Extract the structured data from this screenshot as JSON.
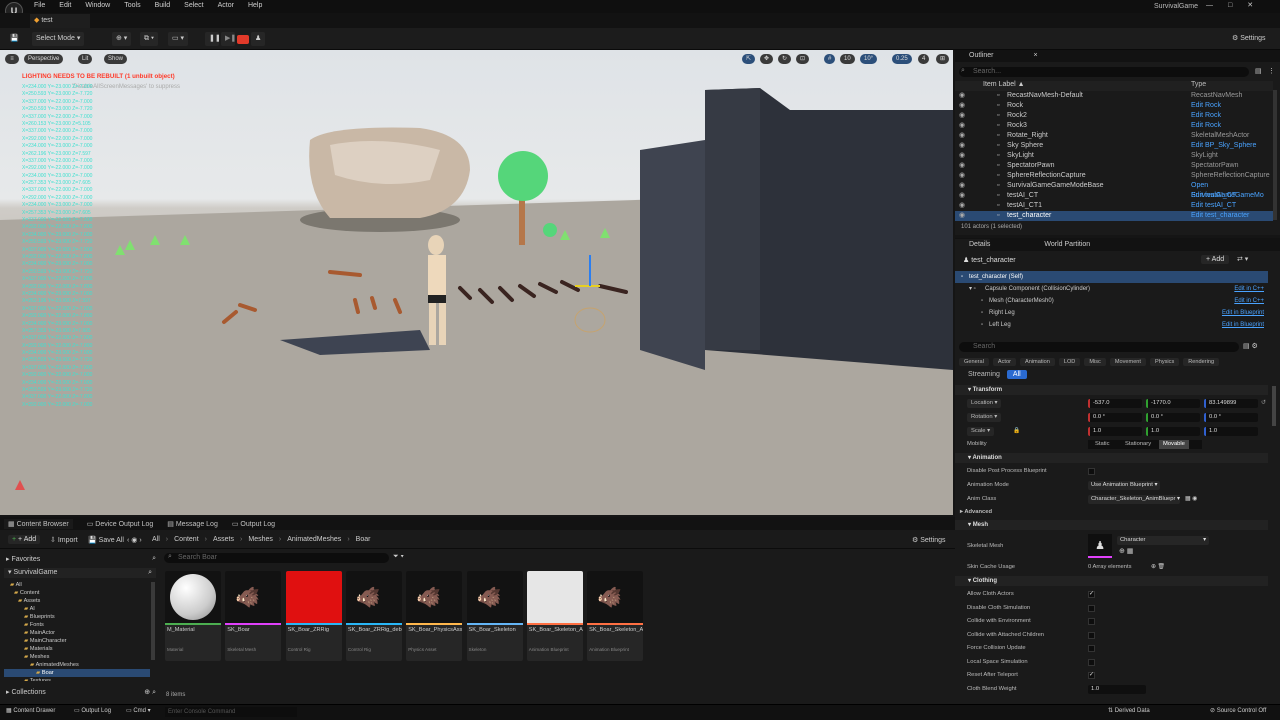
{
  "app": {
    "title": "SurvivalGame",
    "logo": "U",
    "doc_tab": "test"
  },
  "menu": [
    "File",
    "Edit",
    "Window",
    "Tools",
    "Build",
    "Select",
    "Actor",
    "Help"
  ],
  "window_buttons": [
    "—",
    "□",
    "✕"
  ],
  "toolbar": {
    "save_icon": "💾",
    "mode": "Select Mode",
    "settings": "Settings"
  },
  "viewport": {
    "perspective": "Perspective",
    "lit": "Lit",
    "show": "Show",
    "grid_size": "10",
    "angle": "10°",
    "scale": "0.25",
    "cam_speed": "4",
    "warning": "LIGHTING NEEDS TO BE REBUILT (1 unbuilt object)",
    "suppress_hint": "'DisableAllScreenMessages' to suppress",
    "coords": [
      "X=234.000 Y=-23.000 Z=-7.000",
      "X=250.593 Y=-23.000 Z=-7.720",
      "X=337.000 Y=-22.000 Z=-7.000",
      "X=250.593 Y=-23.000 Z=-7.720",
      "X=337.000 Y=-22.000 Z=-7.000",
      "X=260.153 Y=-23.000 Z=5.105",
      "X=337.000 Y=-22.000 Z=-7.000",
      "X=292.000 Y=-22.000 Z=-7.000",
      "X=234.000 Y=-23.000 Z=-7.000",
      "X=262.196 Y=-23.000 Z=7.597",
      "X=337.000 Y=-22.000 Z=-7.000",
      "X=292.000 Y=-22.000 Z=-7.000",
      "X=234.000 Y=-23.000 Z=-7.000",
      "X=257.353 Y=-23.000 Z=7.605",
      "X=337.000 Y=-22.000 Z=-7.000",
      "X=292.000 Y=-22.000 Z=-7.000",
      "X=234.000 Y=-23.000 Z=-7.000",
      "X=257.353 Y=-23.000 Z=7.605",
      "X=337.000 Y=-22.000 Z=-7.000",
      "X=292.000 Y=-22.000 Z=-7.000",
      "X=234.000 Y=-23.000 Z=-7.000",
      "X=250.593 Y=-23.000 Z=-7.720",
      "X=337.000 Y=-22.000 Z=-7.000",
      "X=292.000 Y=-22.000 Z=-7.000",
      "X=234.000 Y=-23.000 Z=-7.000",
      "X=250.593 Y=-23.000 Z=-7.720",
      "X=337.000 Y=-22.000 Z=-7.000",
      "X=292.000 Y=-22.000 Z=-7.000",
      "X=234.000 Y=-23.000 Z=-7.000",
      "X=262.196 Y=-23.000 Z=7.597",
      "X=337.000 Y=-22.000 Z=-7.000",
      "X=292.000 Y=-22.000 Z=-7.000",
      "X=234.000 Y=-23.000 Z=-7.000",
      "X=257.353 Y=-23.000 Z=7.605",
      "X=337.000 Y=-22.000 Z=-7.000",
      "X=292.000 Y=-22.000 Z=-7.000",
      "X=234.000 Y=-23.000 Z=-7.000",
      "X=250.593 Y=-23.000 Z=-7.720",
      "X=337.000 Y=-22.000 Z=-7.000",
      "X=292.000 Y=-22.000 Z=-7.000",
      "X=234.000 Y=-23.000 Z=-7.000",
      "X=250.593 Y=-23.000 Z=-7.720",
      "X=337.000 Y=-22.000 Z=-7.000",
      "X=292.000 Y=-22.000 Z=-7.000"
    ]
  },
  "outliner": {
    "tab": "Outliner",
    "search_placeholder": "Search...",
    "col_label": "Item Label ▲",
    "col_type": "Type",
    "rows": [
      {
        "name": "RecastNavMesh-Default",
        "type": "RecastNavMesh",
        "link": false
      },
      {
        "name": "Rock",
        "type": "Edit Rock",
        "link": true
      },
      {
        "name": "Rock2",
        "type": "Edit Rock",
        "link": true
      },
      {
        "name": "Rock3",
        "type": "Edit Rock",
        "link": true
      },
      {
        "name": "Rotate_Right",
        "type": "SkeletalMeshActor",
        "link": false
      },
      {
        "name": "Sky Sphere",
        "type": "Edit BP_Sky_Sphere",
        "link": true
      },
      {
        "name": "SkyLight",
        "type": "SkyLight",
        "link": false
      },
      {
        "name": "SpectatorPawn",
        "type": "SpectatorPawn",
        "link": false
      },
      {
        "name": "SphereReflectionCapture",
        "type": "SphereReflectionCapture",
        "link": false
      },
      {
        "name": "SurvivalGameGameModeBase",
        "type": "Open SurvivalGameGameMo",
        "link": true
      },
      {
        "name": "testAI_CT",
        "type": "Edit testAI_CT",
        "link": true
      },
      {
        "name": "testAI_CT1",
        "type": "Edit testAI_CT",
        "link": true
      },
      {
        "name": "test_character",
        "type": "Edit test_character",
        "link": true
      }
    ],
    "footer": "101 actors (1 selected)"
  },
  "details": {
    "tab": "Details",
    "tab2": "World Partition",
    "actor": "test_character",
    "add": "+ Add",
    "components": [
      {
        "name": "test_character (Self)",
        "link": ""
      },
      {
        "name": "Capsule Component (CollisionCylinder)",
        "link": "Edit in C++"
      },
      {
        "name": "Mesh (CharacterMesh0)",
        "link": "Edit in C++"
      },
      {
        "name": "Right Leg",
        "link": "Edit in Blueprint"
      },
      {
        "name": "Left Leg",
        "link": "Edit in Blueprint"
      }
    ],
    "search_placeholder": "Search",
    "filters": [
      "General",
      "Actor",
      "Animation",
      "LOD",
      "Misc",
      "Movement",
      "Physics",
      "Rendering"
    ],
    "filters2": [
      "Streaming",
      "All"
    ],
    "transform_header": "Transform",
    "location": {
      "label": "Location",
      "x": "-537.0",
      "y": "-1770.0",
      "z": "83.149899"
    },
    "rotation": {
      "label": "Rotation",
      "x": "0.0 °",
      "y": "0.0 °",
      "z": "0.0 °"
    },
    "scale": {
      "label": "Scale",
      "x": "1.0",
      "y": "1.0",
      "z": "1.0"
    },
    "mobility": {
      "label": "Mobility",
      "options": [
        "Static",
        "Stationary",
        "Movable"
      ]
    },
    "anim_header": "Animation",
    "anim_props": [
      {
        "label": "Disable Post Process Blueprint",
        "value": ""
      },
      {
        "label": "Animation Mode",
        "value": "Use Animation Blueprint"
      },
      {
        "label": "Anim Class",
        "value": "Character_Skeleton_AnimBluepr"
      }
    ],
    "advanced": "Advanced",
    "mesh_header": "Mesh",
    "skeletal_mesh": {
      "label": "Skeletal Mesh",
      "value": "Character"
    },
    "skin_cache": {
      "label": "Skin Cache Usage",
      "value": "0 Array elements"
    },
    "clothing_header": "Clothing",
    "clothing": [
      {
        "label": "Allow Cloth Actors",
        "checked": "✓"
      },
      {
        "label": "Disable Cloth Simulation",
        "checked": ""
      },
      {
        "label": "Collide with Environment",
        "checked": ""
      },
      {
        "label": "Collide with Attached Children",
        "checked": ""
      },
      {
        "label": "Force Collision Update",
        "checked": ""
      },
      {
        "label": "Local Space Simulation",
        "checked": ""
      },
      {
        "label": "Reset After Teleport",
        "checked": "✓"
      }
    ],
    "cloth_blend": {
      "label": "Cloth Blend Weight",
      "value": "1.0"
    }
  },
  "bottom_tabs": [
    "Content Browser",
    "Device Output Log",
    "Message Log",
    "Output Log"
  ],
  "cb": {
    "add": "+ Add",
    "import": "Import",
    "save_all": "Save All",
    "path": [
      "All",
      "Content",
      "Assets",
      "Meshes",
      "AnimatedMeshes",
      "Boar"
    ],
    "settings": "Settings",
    "favorites": "Favorites",
    "project": "SurvivalGame",
    "search_placeholder": "Search Boar",
    "tree": [
      "All",
      "Content",
      "Assets",
      "AI",
      "Blueprints",
      "Fonts",
      "MainActor",
      "MainCharacter",
      "Materials",
      "Meshes",
      "AnimatedMeshes",
      "Boar",
      "Textures"
    ],
    "collections": "Collections",
    "item_count": "8 items",
    "assets": [
      {
        "name": "M_Material",
        "type": "Material",
        "color": "#4caf50"
      },
      {
        "name": "SK_Boar",
        "type": "Skeletal Mesh",
        "color": "#e040fb"
      },
      {
        "name": "SK_Boar_ZRRig",
        "type": "Control Rig",
        "color": "#29b6f6"
      },
      {
        "name": "SK_Boar_ZRRig_debug",
        "type": "Control Rig",
        "color": "#29b6f6"
      },
      {
        "name": "SK_Boar_PhysicsAsset",
        "type": "Physics Asset",
        "color": "#ffb74d"
      },
      {
        "name": "SK_Boar_Skeleton",
        "type": "Skeleton",
        "color": "#64b5f6"
      },
      {
        "name": "SK_Boar_Skeleton_AnimBlueprint",
        "type": "Animation Blueprint",
        "color": "#ff7043"
      },
      {
        "name": "SK_Boar_Skeleton_AnimBlueprint_debug",
        "type": "Animation Blueprint",
        "color": "#ff7043"
      }
    ]
  },
  "status": {
    "drawer": "Content Drawer",
    "output": "Output Log",
    "cmd": "Cmd",
    "console_placeholder": "Enter Console Command",
    "derived": "Derived Data",
    "source": "Source Control Off"
  }
}
